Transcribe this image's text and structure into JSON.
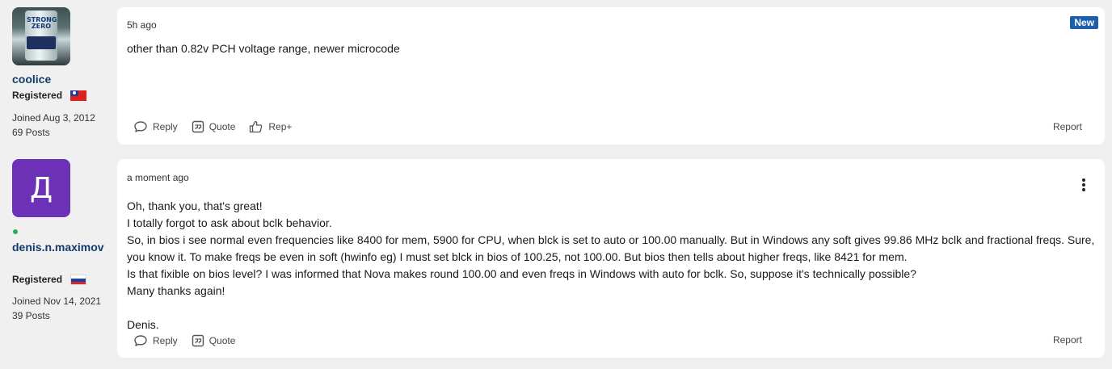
{
  "posts": [
    {
      "author": {
        "name": "coolice",
        "role": "Registered",
        "joined": "Joined Aug 3, 2012",
        "posts": "69 Posts",
        "avatar_text": "STRONG ZERO",
        "flag": "taiwan-flag",
        "online": false
      },
      "time": "5h ago",
      "badge": "New",
      "body": [
        "other than 0.82v PCH voltage range, newer microcode"
      ],
      "actions": {
        "reply": "Reply",
        "quote": "Quote",
        "rep": "Rep+",
        "report": "Report"
      }
    },
    {
      "author": {
        "name": "denis.n.maximov",
        "role": "Registered",
        "joined": "Joined Nov 14, 2021",
        "posts": "39 Posts",
        "avatar_letter": "Д",
        "avatar_color": "#6d31b8",
        "flag": "russia-flag",
        "online": true
      },
      "time": "a moment ago",
      "body": [
        "Oh, thank you, that's great!",
        "I totally forgot to ask about bclk behavior.",
        "So, in bios i see normal even frequencies like 8400 for mem, 5900 for CPU, when blck is set to auto or 100.00 manually. But in Windows any soft gives 99.86 MHz bclk and fractional freqs. Sure, you know it. To make freqs be even in soft (hwinfo eg) I must set blck in bios of 100.25, not 100.00. But bios then tells about higher freqs, like 8421 for mem.",
        "Is that fixible on bios level? I was informed that Nova makes round 100.00 and even freqs in Windows with auto for bclk. So, suppose it's technically possible?",
        "Many thanks again!",
        "",
        "Denis."
      ],
      "actions": {
        "reply": "Reply",
        "quote": "Quote",
        "report": "Report"
      }
    }
  ],
  "colors": {
    "page_bg": "#f0f0f0",
    "card_bg": "#ffffff",
    "username": "#143a6b",
    "badge_new": "#1b5fae",
    "online": "#27ae60"
  }
}
